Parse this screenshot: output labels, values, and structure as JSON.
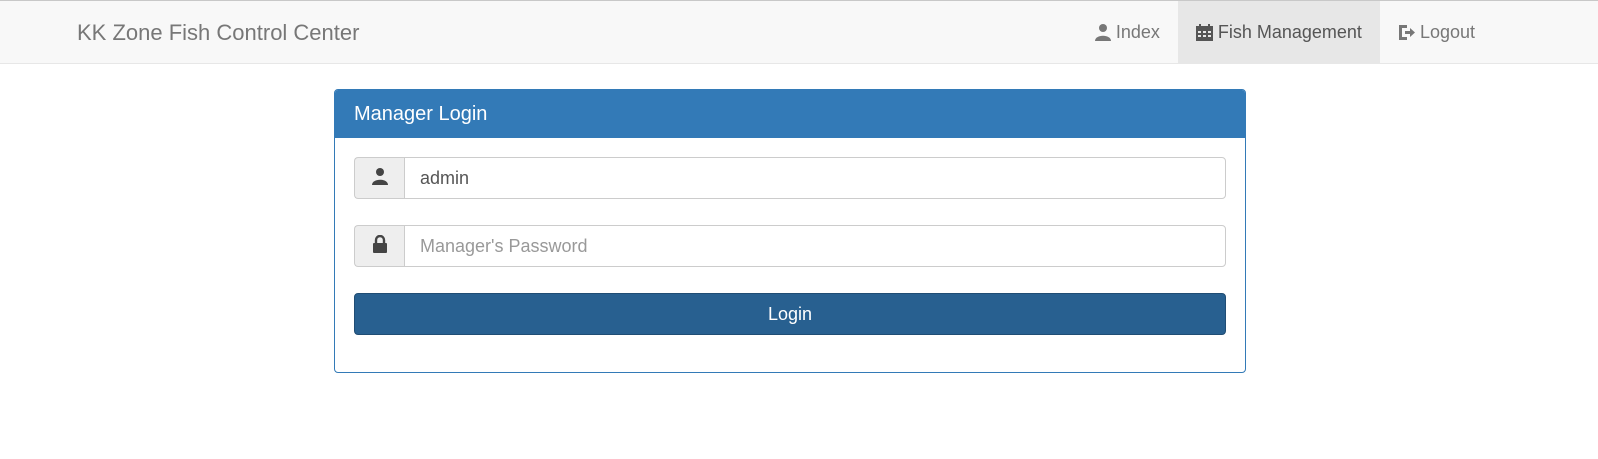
{
  "navbar": {
    "brand": "KK Zone Fish Control Center",
    "items": [
      {
        "label": "Index",
        "icon": "user-icon"
      },
      {
        "label": "Fish Management",
        "icon": "calendar-icon",
        "active": true
      },
      {
        "label": "Logout",
        "icon": "logout-icon"
      }
    ]
  },
  "login_panel": {
    "title": "Manager Login",
    "username": {
      "value": "admin",
      "icon": "user-icon"
    },
    "password": {
      "value": "",
      "placeholder": "Manager's Password",
      "icon": "lock-icon"
    },
    "submit_label": "Login"
  },
  "colors": {
    "primary": "#337ab7",
    "button": "#286090",
    "navbar_bg": "#f8f8f8",
    "active_nav_bg": "#e7e7e7"
  }
}
